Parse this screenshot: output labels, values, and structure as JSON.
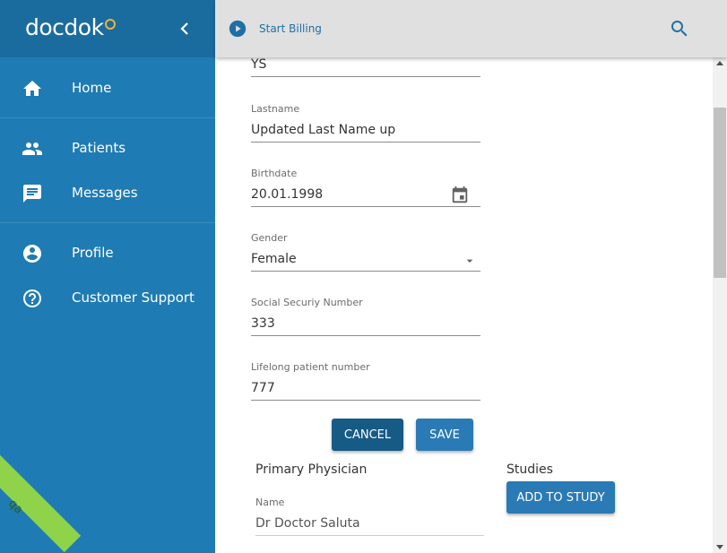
{
  "app": {
    "logo_text": "docdok",
    "environment_badge": "qa"
  },
  "sidebar": {
    "items": [
      {
        "label": "Home",
        "icon": "home-icon"
      },
      {
        "label": "Patients",
        "icon": "people-icon"
      },
      {
        "label": "Messages",
        "icon": "message-icon"
      },
      {
        "label": "Profile",
        "icon": "account-circle-icon"
      },
      {
        "label": "Customer Support",
        "icon": "help-circle-icon"
      }
    ]
  },
  "topbar": {
    "billing_label": "Start Billing",
    "search_icon": "search-icon"
  },
  "form": {
    "firstname_value": "YS",
    "lastname": {
      "label": "Lastname",
      "value": "Updated Last Name up"
    },
    "birthdate": {
      "label": "Birthdate",
      "value": "20.01.1998"
    },
    "gender": {
      "label": "Gender",
      "value": "Female"
    },
    "ssn": {
      "label": "Social Securiy Number",
      "value": "333"
    },
    "lifelong": {
      "label": "Lifelong patient number",
      "value": "777"
    }
  },
  "buttons": {
    "cancel": "CANCEL",
    "save": "SAVE",
    "add_to_study": "ADD TO STUDY"
  },
  "primary_physician": {
    "title": "Primary Physician",
    "name_label": "Name",
    "name_value": "Dr Doctor Saluta"
  },
  "studies": {
    "title": "Studies"
  },
  "colors": {
    "sidebar": "#1f7bb3",
    "sidebar_header": "#1a6c9e",
    "topbar": "#e0e0e0",
    "primary_button": "#2a7ab5",
    "cancel_button": "#165a86",
    "qa_badge": "#8ed34a"
  }
}
